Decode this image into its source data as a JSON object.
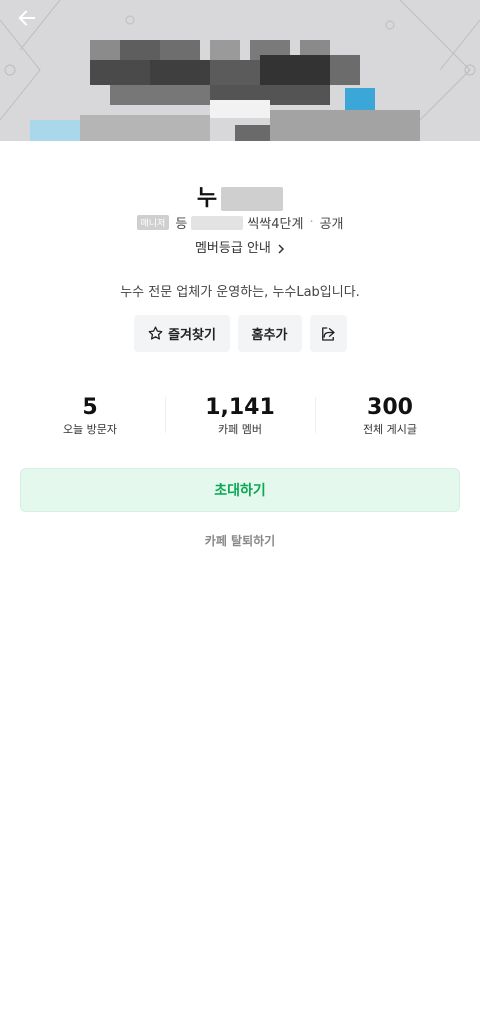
{
  "header": {
    "back_icon": "arrow-left-icon"
  },
  "profile": {
    "cafe_name": "누",
    "manager_badge": "매니저",
    "meta_prefix": "등",
    "grade_text": "씩싹4단계",
    "visibility_sep": "·",
    "visibility": "공개",
    "member_grade_link": "멤버등급 안내",
    "intro": "누수 전문 업체가 운영하는, 누수Lab입니다."
  },
  "actions": {
    "favorite_label": "즐겨찾기",
    "favorite_icon": "star-outline-icon",
    "home_add_label": "홈추가",
    "share_icon": "share-icon"
  },
  "stats": [
    {
      "value": "5",
      "label": "오늘 방문자"
    },
    {
      "value": "1,141",
      "label": "카페 멤버"
    },
    {
      "value": "300",
      "label": "전체 게시글"
    }
  ],
  "invite_label": "초대하기",
  "leave_label": "카페 탈퇴하기",
  "colors": {
    "accent": "#0aa853",
    "invite_bg": "#e4f8ee",
    "chip_bg": "#f3f4f6"
  }
}
